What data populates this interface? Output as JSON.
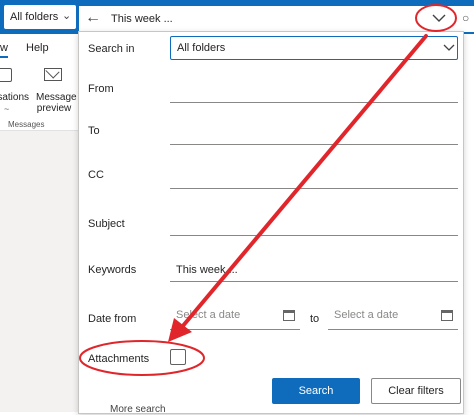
{
  "topbar": {
    "folder_scope": "All folders",
    "search_query": "This week ..."
  },
  "ribbon": {
    "tab_left_partial": "w",
    "tab_help": "Help",
    "btn_conversations_partial": "rsations",
    "btn_conversations_sub": "~",
    "btn_message_preview": "Message preview",
    "group_label": "Messages"
  },
  "search_panel": {
    "search_in_label": "Search in",
    "search_in_value": "All folders",
    "from_label": "From",
    "to_label": "To",
    "cc_label": "CC",
    "subject_label": "Subject",
    "keywords_label": "Keywords",
    "keywords_value": "This week ...",
    "date_from_label": "Date from",
    "date_from_placeholder": "Select a date",
    "date_to_word": "to",
    "date_to_placeholder": "Select a date",
    "attachments_label": "Attachments",
    "search_button": "Search",
    "clear_button": "Clear filters"
  },
  "background": {
    "partial_text": "More search"
  },
  "colors": {
    "brand_blue": "#0f6cbd",
    "annotation_red": "#e0262b"
  }
}
